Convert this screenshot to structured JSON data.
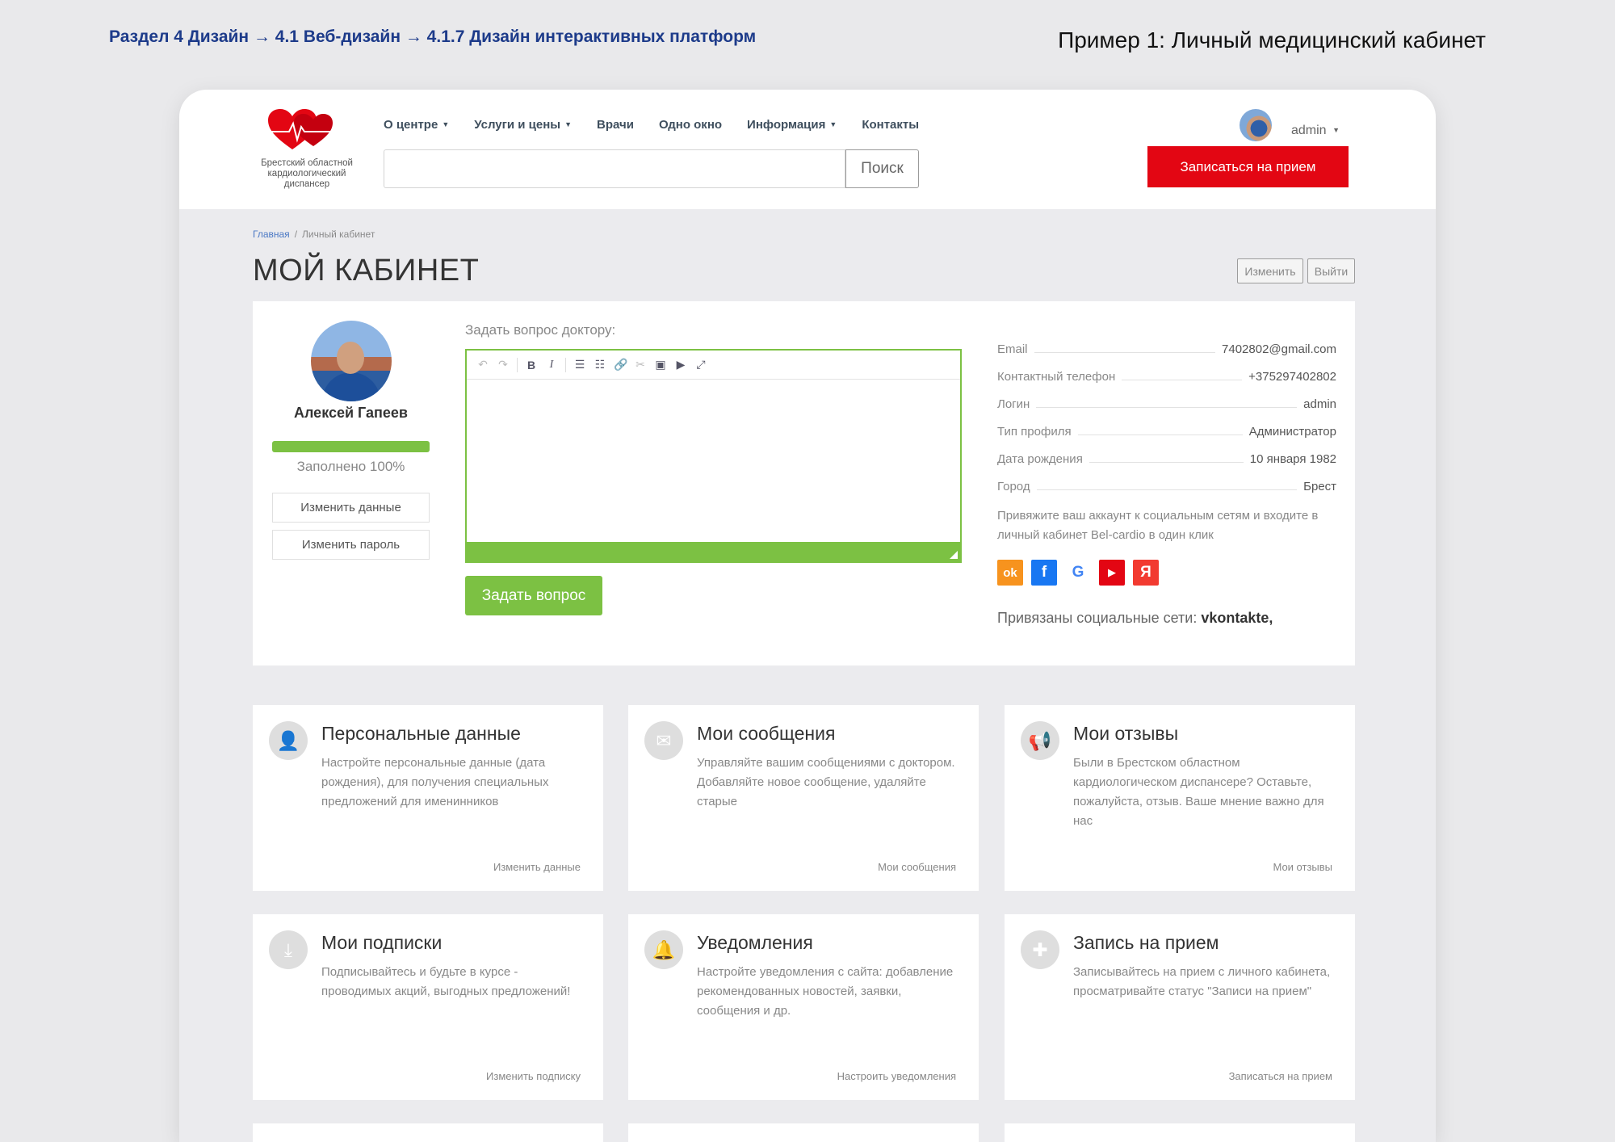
{
  "slide": {
    "breadcrumb": "Раздел 4 Дизайн  → 4.1 Веб-дизайн → 4.1.7 Дизайн интерактивных платформ",
    "title": "Пример 1: Личный медицинский кабинет"
  },
  "header": {
    "logo_text": "Брестский областной кардиологический диспансер",
    "nav": [
      {
        "label": "О центре",
        "caret": true
      },
      {
        "label": "Услуги и цены",
        "caret": true
      },
      {
        "label": "Врачи",
        "caret": false
      },
      {
        "label": "Одно окно",
        "caret": false
      },
      {
        "label": "Информация",
        "caret": true
      },
      {
        "label": "Контакты",
        "caret": false
      }
    ],
    "search_button": "Поиск",
    "user_name": "admin",
    "appointment_button": "Записаться на прием"
  },
  "breadcrumb": {
    "home": "Главная",
    "sep": "/",
    "current": "Личный кабинет"
  },
  "page_title": "МОЙ КАБИНЕТ",
  "actions": {
    "edit": "Изменить",
    "logout": "Выйти"
  },
  "profile": {
    "name": "Алексей Гапеев",
    "progress": 100,
    "progress_label": "Заполнено 100%",
    "edit_data": "Изменить данные",
    "edit_password": "Изменить пароль"
  },
  "question": {
    "label": "Задать вопрос доктору:",
    "submit": "Задать вопрос"
  },
  "info": [
    {
      "label": "Email",
      "value": "7402802@gmail.com"
    },
    {
      "label": "Контактный телефон",
      "value": "+375297402802"
    },
    {
      "label": "Логин",
      "value": "admin"
    },
    {
      "label": "Тип профиля",
      "value": "Администратор"
    },
    {
      "label": "Дата рождения",
      "value": "10 января 1982"
    },
    {
      "label": "Город",
      "value": "Брест"
    }
  ],
  "social": {
    "note": "Привяжите ваш аккаунт к социальным сетям и входите в личный кабинет Bel-cardio в один клик",
    "networks": [
      {
        "name": "odnoklassniki",
        "glyph": "ok",
        "color": "#f7931e"
      },
      {
        "name": "facebook",
        "glyph": "f",
        "color": "#1877f2"
      },
      {
        "name": "google",
        "glyph": "G",
        "color": "#ffffff"
      },
      {
        "name": "youtube",
        "glyph": "▶",
        "color": "#e30613"
      },
      {
        "name": "yandex",
        "glyph": "Я",
        "color": "#f23a30"
      }
    ],
    "bound_label": "Привязаны социальные сети:",
    "bound_value": "vkontakte,"
  },
  "cards": [
    {
      "icon": "user-icon",
      "glyph": "👤",
      "title": "Персональные данные",
      "text": "Настройте персональные данные (дата рождения), для получения специальных предложений для именинников",
      "link": "Изменить данные"
    },
    {
      "icon": "envelope-icon",
      "glyph": "✉",
      "title": "Мои сообщения",
      "text": "Управляйте вашим сообщениями с доктором. Добавляйте новое сообщение, удаляйте старые",
      "link": "Мои сообщения"
    },
    {
      "icon": "megaphone-icon",
      "glyph": "📢",
      "title": "Мои отзывы",
      "text": "Были в Брестском областном кардиологическом диспансере? Оставьте, пожалуйста, отзыв. Ваше мнение важно для нас",
      "link": "Мои отзывы"
    },
    {
      "icon": "inbox-download-icon",
      "glyph": "⤓",
      "title": "Мои подписки",
      "text": "Подписывайтесь и будьте в курсе - проводимых акций, выгодных предложений!",
      "link": "Изменить подписку"
    },
    {
      "icon": "bell-icon",
      "glyph": "🔔",
      "title": "Уведомления",
      "text": "Настройте уведомления с сайта: добавление рекомендованных новостей, заявки, сообщения и др.",
      "link": "Настроить уведомления"
    },
    {
      "icon": "clipboard-plus-icon",
      "glyph": "✚",
      "title": "Запись на прием",
      "text": "Записывайтесь на прием с личного кабинета, просматривайте статус \"Записи на прием\"",
      "link": "Записаться на прием"
    }
  ]
}
